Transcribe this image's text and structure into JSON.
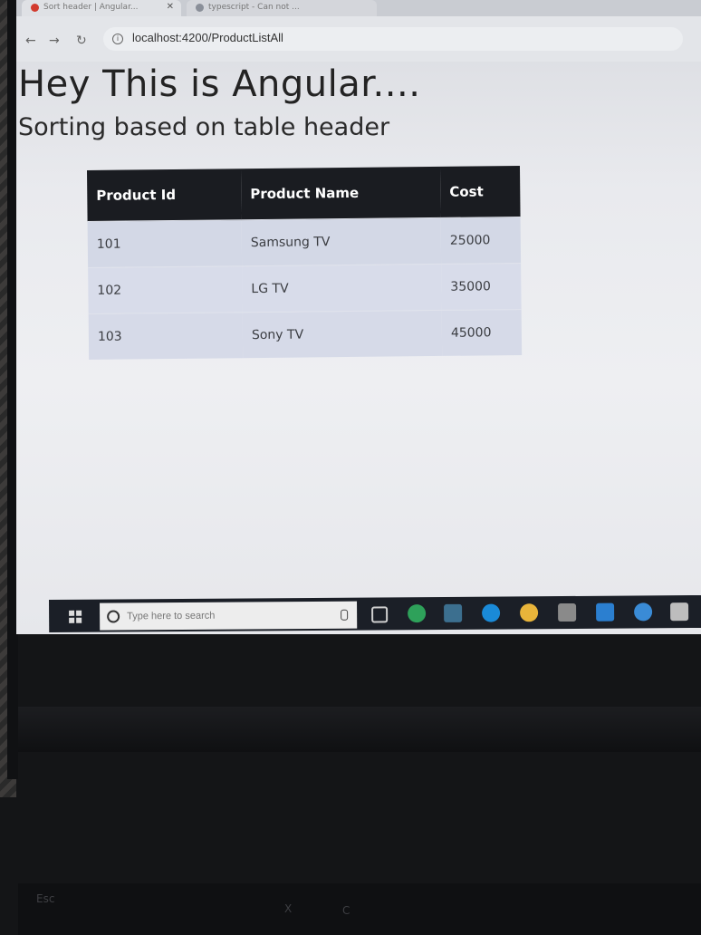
{
  "browser": {
    "tabs": [
      {
        "title": "Sort header | Angular..."
      },
      {
        "title": "typescript - Can not ..."
      }
    ],
    "url": "localhost:4200/ProductListAll"
  },
  "page": {
    "heading": "Hey This is Angular....",
    "subheading": "Sorting based on table header"
  },
  "table": {
    "headers": [
      "Product Id",
      "Product Name",
      "Cost"
    ],
    "rows": [
      [
        "101",
        "Samsung TV",
        "25000"
      ],
      [
        "102",
        "LG TV",
        "35000"
      ],
      [
        "103",
        "Sony TV",
        "45000"
      ]
    ]
  },
  "taskbar": {
    "search_placeholder": "Type here to search"
  },
  "keyboard": {
    "visible_keys": [
      "Esc",
      "X",
      "C"
    ]
  },
  "colors": {
    "table_header_bg": "#1a1c21",
    "table_row_bg": "#d3d8e6",
    "taskbar_bg": "#1b1f27"
  }
}
